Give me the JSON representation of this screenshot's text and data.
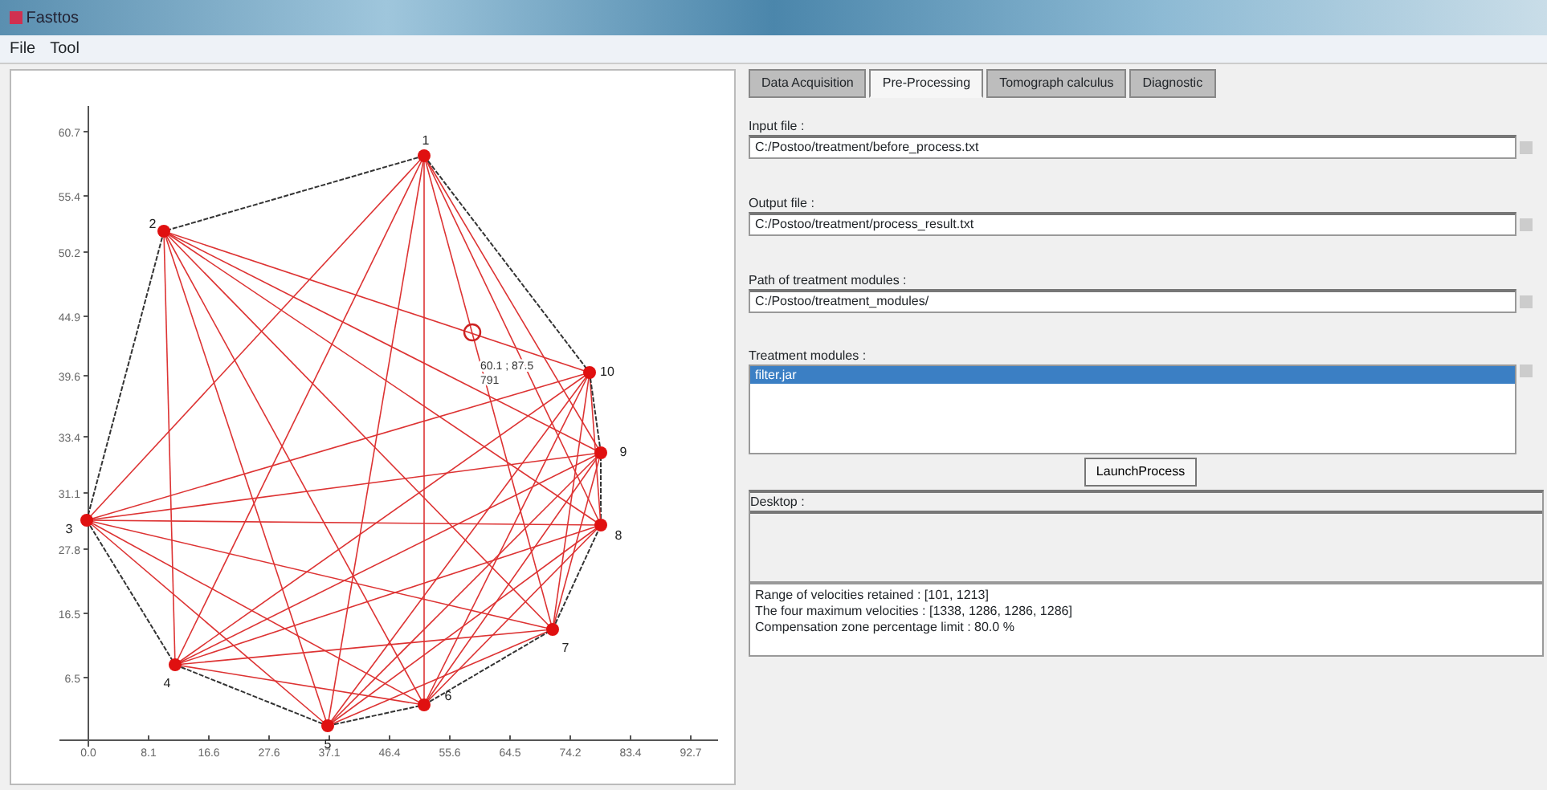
{
  "window": {
    "title": "Fasttos"
  },
  "menu": [
    "File",
    "Tool"
  ],
  "plot": {
    "y_ticks": [
      "60.7",
      "55.4",
      "50.2",
      "44.9",
      "39.6",
      "33.4",
      "31.1",
      "27.8",
      "16.5",
      "6.5"
    ],
    "x_ticks": [
      "0.0",
      "8.1",
      "16.6",
      "27.6",
      "37.1",
      "46.4",
      "55.6",
      "64.5",
      "74.2",
      "83.4",
      "92.7"
    ],
    "nodes": [
      "1",
      "2",
      "3",
      "4",
      "5",
      "6",
      "7",
      "8",
      "9",
      "10"
    ],
    "tooltip": [
      "60.1 ; 87.5",
      "791"
    ]
  },
  "tabs": [
    {
      "label": "Data Acquisition",
      "selected": false
    },
    {
      "label": "Pre-Processing",
      "selected": true
    },
    {
      "label": "Tomograph calculus",
      "selected": false
    },
    {
      "label": "Diagnostic",
      "selected": false
    }
  ],
  "fields": [
    {
      "label": "Input file :",
      "value": "C:/Postoo/treatment/before_process.txt"
    },
    {
      "label": "Output file :",
      "value": "C:/Postoo/treatment/process_result.txt"
    },
    {
      "label": "Path of treatment modules :",
      "value": "C:/Postoo/treatment_modules/"
    }
  ],
  "modules": {
    "label": "Treatment modules :",
    "items": [
      {
        "text": "filter.jar",
        "selected": true
      }
    ]
  },
  "launch_button": "LaunchProcess",
  "desktop": {
    "label": "Desktop :"
  },
  "log": [
    "Range of velocities retained : [101, 1213]",
    "The four maximum velocities : [1338, 1286, 1286, 1286]",
    "Compensation zone percentage limit : 80.0 %"
  ]
}
